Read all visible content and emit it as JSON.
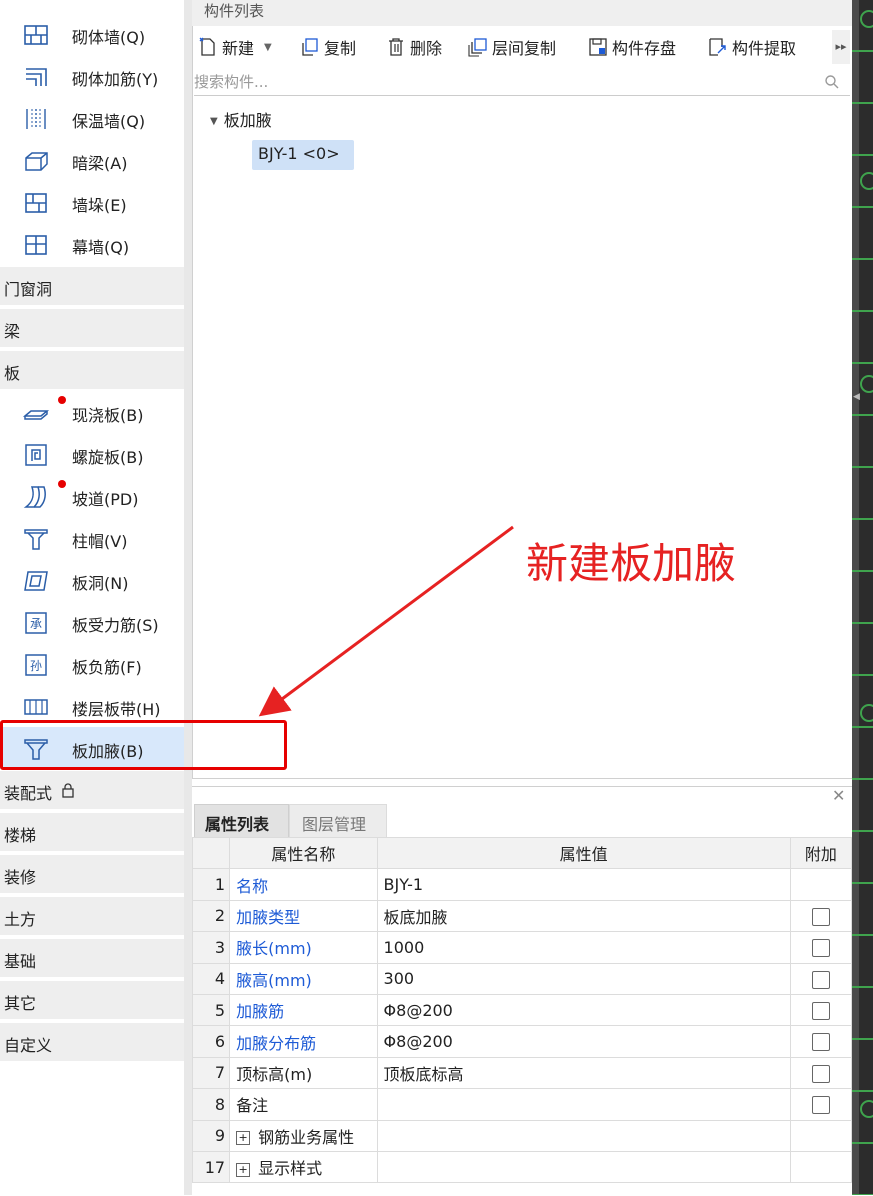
{
  "sidebar": {
    "items_top": [
      {
        "label": "砌体墙(Q)",
        "icon": "masonry-wall-icon"
      },
      {
        "label": "砌体加筋(Y)",
        "icon": "masonry-rebar-icon"
      },
      {
        "label": "保温墙(Q)",
        "icon": "insulation-wall-icon"
      },
      {
        "label": "暗梁(A)",
        "icon": "hidden-beam-icon"
      },
      {
        "label": "墙垛(E)",
        "icon": "wall-pier-icon"
      },
      {
        "label": "幕墙(Q)",
        "icon": "curtain-wall-icon"
      }
    ],
    "cat_door": "门窗洞",
    "cat_beam": "梁",
    "cat_slab": "板",
    "items_slab": [
      {
        "label": "现浇板(B)",
        "icon": "cast-slab-icon"
      },
      {
        "label": "螺旋板(B)",
        "icon": "spiral-slab-icon"
      },
      {
        "label": "坡道(PD)",
        "icon": "ramp-icon"
      },
      {
        "label": "柱帽(V)",
        "icon": "column-cap-icon"
      },
      {
        "label": "板洞(N)",
        "icon": "slab-hole-icon"
      },
      {
        "label": "板受力筋(S)",
        "icon": "slab-main-rebar-icon"
      },
      {
        "label": "板负筋(F)",
        "icon": "slab-negative-rebar-icon"
      },
      {
        "label": "楼层板带(H)",
        "icon": "floor-slab-strip-icon"
      },
      {
        "label": "板加腋(B)",
        "icon": "slab-haunch-icon"
      }
    ],
    "cats_bottom": [
      "装配式",
      "楼梯",
      "装修",
      "土方",
      "基础",
      "其它",
      "自定义"
    ]
  },
  "component_list": {
    "title": "构件列表",
    "toolbar": {
      "new": "新建",
      "copy": "复制",
      "delete": "删除",
      "floor_copy": "层间复制",
      "save": "构件存盘",
      "extract": "构件提取"
    },
    "search_placeholder": "搜索构件...",
    "tree_root": "板加腋",
    "tree_leaf": "BJY-1 <0>"
  },
  "properties": {
    "tab_active": "属性列表",
    "tab_other": "图层管理",
    "headers": {
      "name": "属性名称",
      "value": "属性值",
      "extra": "附加"
    },
    "rows": [
      {
        "num": "1",
        "name": "名称",
        "value": "BJY-1",
        "blue": true,
        "checkbox": false
      },
      {
        "num": "2",
        "name": "加腋类型",
        "value": "板底加腋",
        "blue": true,
        "checkbox": true
      },
      {
        "num": "3",
        "name": "腋长(mm)",
        "value": "1000",
        "blue": true,
        "checkbox": true
      },
      {
        "num": "4",
        "name": "腋高(mm)",
        "value": "300",
        "blue": true,
        "checkbox": true
      },
      {
        "num": "5",
        "name": "加腋筋",
        "value": "Φ8@200",
        "blue": true,
        "checkbox": true
      },
      {
        "num": "6",
        "name": "加腋分布筋",
        "value": "Φ8@200",
        "blue": true,
        "checkbox": true
      },
      {
        "num": "7",
        "name": "顶标高(m)",
        "value": "顶板底标高",
        "blue": false,
        "checkbox": true
      },
      {
        "num": "8",
        "name": "备注",
        "value": "",
        "blue": false,
        "checkbox": true
      }
    ],
    "group_rows": [
      {
        "num": "9",
        "name": "钢筋业务属性"
      },
      {
        "num": "17",
        "name": "显示样式"
      }
    ]
  },
  "annotation": {
    "text": "新建板加腋",
    "color": "#e62222"
  }
}
